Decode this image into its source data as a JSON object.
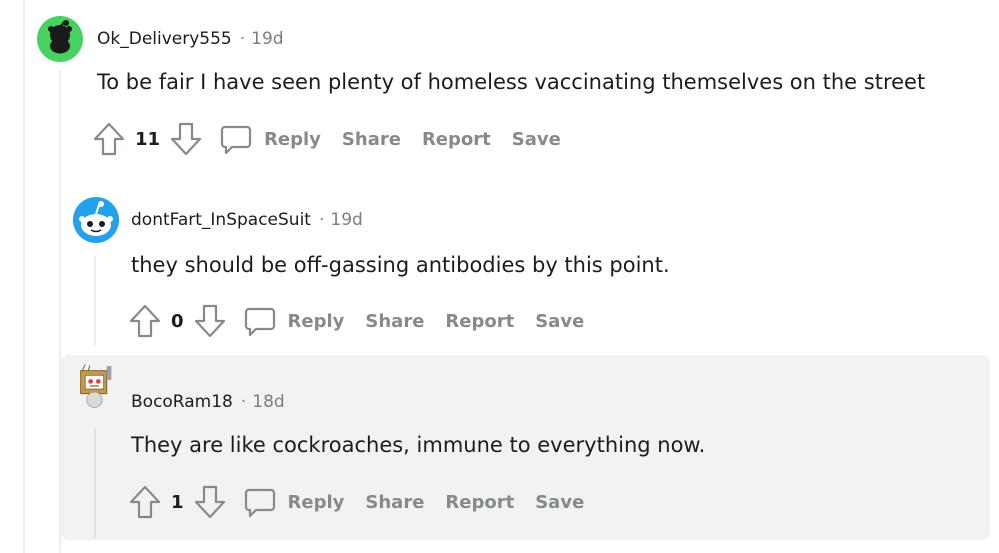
{
  "comments": [
    {
      "username": "Ok_Delivery555",
      "time": "19d",
      "text": "To be fair I have seen plenty of homeless vaccinating themselves on the street",
      "votes": "11",
      "reply_label": "Reply",
      "share_label": "Share",
      "report_label": "Report",
      "save_label": "Save",
      "avatar_color": "#46d160"
    },
    {
      "username": "dontFart_InSpaceSuit",
      "time": "19d",
      "text": "they should be off-gassing antibodies by this point.",
      "votes": "0",
      "reply_label": "Reply",
      "share_label": "Share",
      "report_label": "Report",
      "save_label": "Save",
      "avatar_color": "#24a0ed"
    },
    {
      "username": "BocoRam18",
      "time": "18d",
      "text": "They are like cockroaches, immune to everything now.",
      "votes": "1",
      "reply_label": "Reply",
      "share_label": "Share",
      "report_label": "Report",
      "save_label": "Save",
      "avatar_color": "#c49a4a"
    }
  ],
  "separator": "·",
  "colors": {
    "muted": "#878a8c",
    "highlight": "#f2f2f2",
    "thread_line": "#edeff1"
  }
}
